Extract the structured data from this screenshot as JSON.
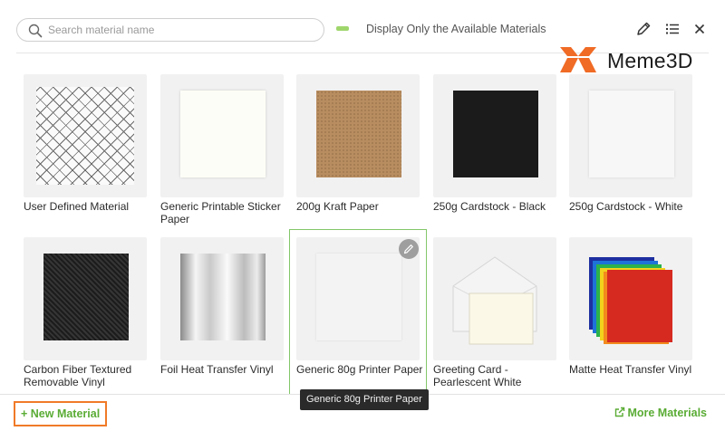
{
  "search": {
    "placeholder": "Search material name",
    "value": ""
  },
  "filter": {
    "label": "Display Only the Available Materials",
    "toggle_color": "#9fd66c"
  },
  "toolbar": {
    "edit_icon": "pencil-icon",
    "list_icon": "list-icon",
    "close_icon": "close-icon"
  },
  "watermark": {
    "text": "Meme3D",
    "brand_color": "#f06b25"
  },
  "materials": [
    {
      "name": "User Defined Material"
    },
    {
      "name": "Generic Printable Sticker Paper"
    },
    {
      "name": "200g Kraft Paper"
    },
    {
      "name": "250g Cardstock - Black"
    },
    {
      "name": "250g Cardstock - White"
    },
    {
      "name": "Carbon Fiber Textured Removable Vinyl"
    },
    {
      "name": "Foil Heat Transfer Vinyl"
    },
    {
      "name": "Generic 80g Printer Paper",
      "selected": true
    },
    {
      "name": "Greeting Card - Pearlescent White"
    },
    {
      "name": "Matte Heat Transfer Vinyl"
    }
  ],
  "tooltip": {
    "text": "Generic 80g Printer Paper"
  },
  "footer": {
    "new_material": "+ New Material",
    "more_materials": "More Materials"
  },
  "colors": {
    "accent_green": "#5aac35",
    "highlight_orange": "#f07a28",
    "selected_border": "#83c76a"
  }
}
